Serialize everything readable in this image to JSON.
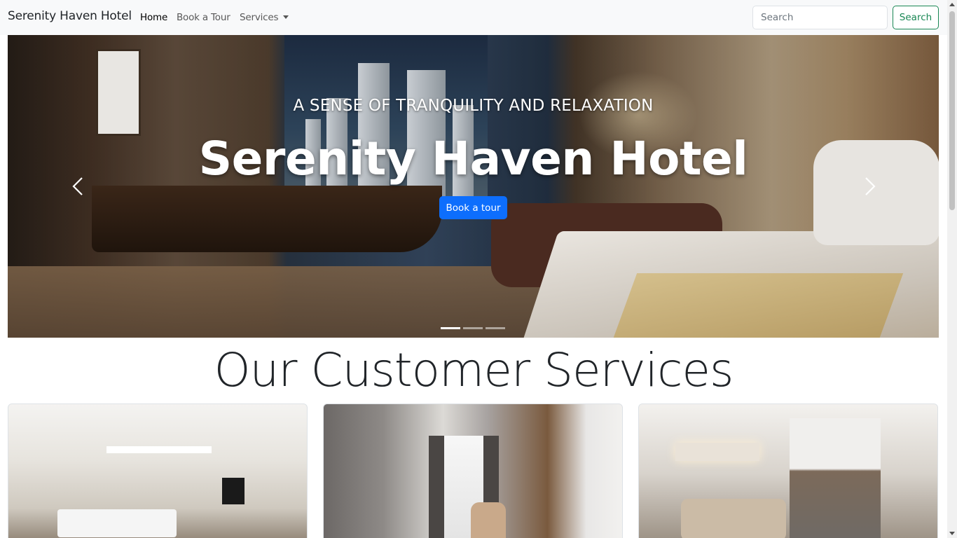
{
  "navbar": {
    "brand": "Serenity Haven Hotel",
    "links": [
      {
        "label": "Home"
      },
      {
        "label": "Book a Tour"
      },
      {
        "label": "Services"
      }
    ],
    "search": {
      "placeholder": "Search",
      "value": ""
    },
    "search_button": "Search"
  },
  "hero": {
    "kicker": "A SENSE OF TRANQUILITY AND RELAXATION",
    "title": "Serenity Haven Hotel",
    "cta": "Book a tour",
    "slide_count": 3,
    "active_slide": 1,
    "prev_icon": "chevron-left-icon",
    "next_icon": "chevron-right-icon"
  },
  "services": {
    "title": "Our Customer Services",
    "cards": [
      {
        "image": "hotel-room-image"
      },
      {
        "image": "room-interior-image"
      },
      {
        "image": "apartment-suite-image"
      }
    ]
  },
  "colors": {
    "primary": "#0d6efd",
    "success": "#198754",
    "navbar_bg": "#f8f9fa"
  }
}
